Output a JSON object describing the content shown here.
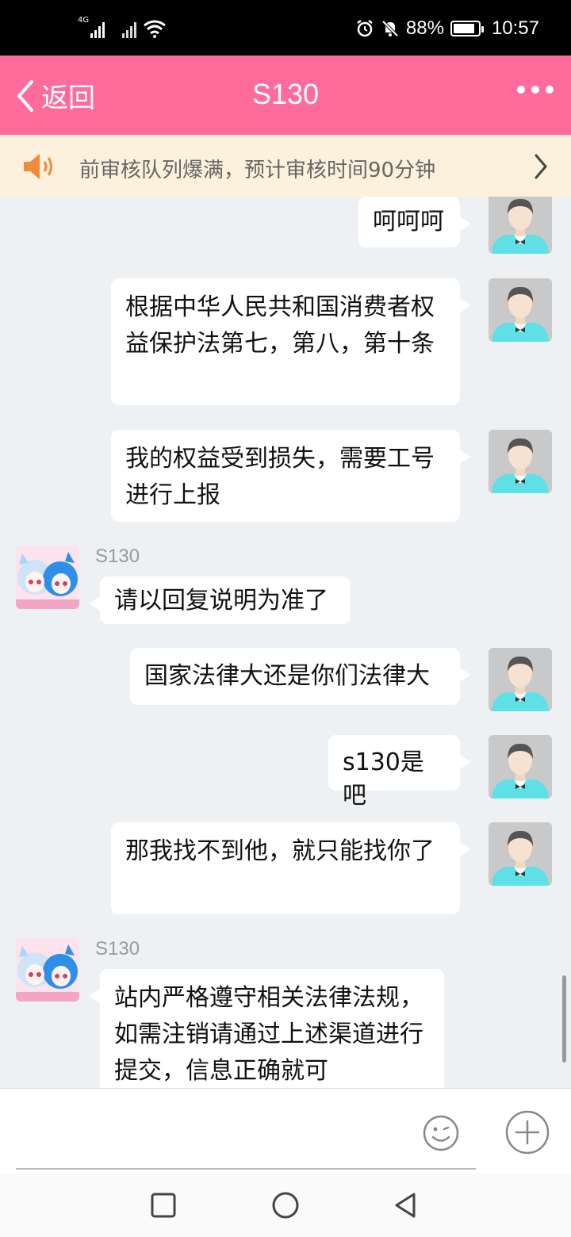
{
  "status_bar": {
    "battery": "88%",
    "time": "10:57",
    "network_label": "4G",
    "battery_level": 0.88
  },
  "header": {
    "back_label": "返回",
    "title": "S130"
  },
  "notice": {
    "text": "前审核队列爆满，预计审核时间90分钟"
  },
  "messages": [
    {
      "from": "me",
      "text": "呵呵呵"
    },
    {
      "from": "me",
      "text": "根据中华人民共和国消费者权益保护法第七，第八，第十条"
    },
    {
      "from": "me",
      "text": "我的权益受到损失，需要工号进行上报"
    },
    {
      "from": "bot",
      "sender": "S130",
      "text": "请以回复说明为准了"
    },
    {
      "from": "me",
      "text": "国家法律大还是你们法律大"
    },
    {
      "from": "me",
      "text": "s130是吧"
    },
    {
      "from": "me",
      "text": "那我找不到他，就只能找你了"
    },
    {
      "from": "bot",
      "sender": "S130",
      "text": "站内严格遵守相关法律法规，如需注销请通过上述渠道进行提交，信息正确就可"
    }
  ],
  "icons": {
    "back": "chevron-left-icon",
    "more": "more-icon",
    "speaker": "speaker-icon",
    "emoji": "emoji-icon",
    "plus": "plus-icon",
    "nav_recents": "square-icon",
    "nav_home": "circle-icon",
    "nav_back": "triangle-back-icon"
  },
  "colors": {
    "header": "#ff6b9b",
    "notice_bg": "#fbf1dd",
    "chat_bg": "#eef1f3",
    "speaker": "#f08a3c",
    "avatar_shirt": "#5ee0e6"
  }
}
